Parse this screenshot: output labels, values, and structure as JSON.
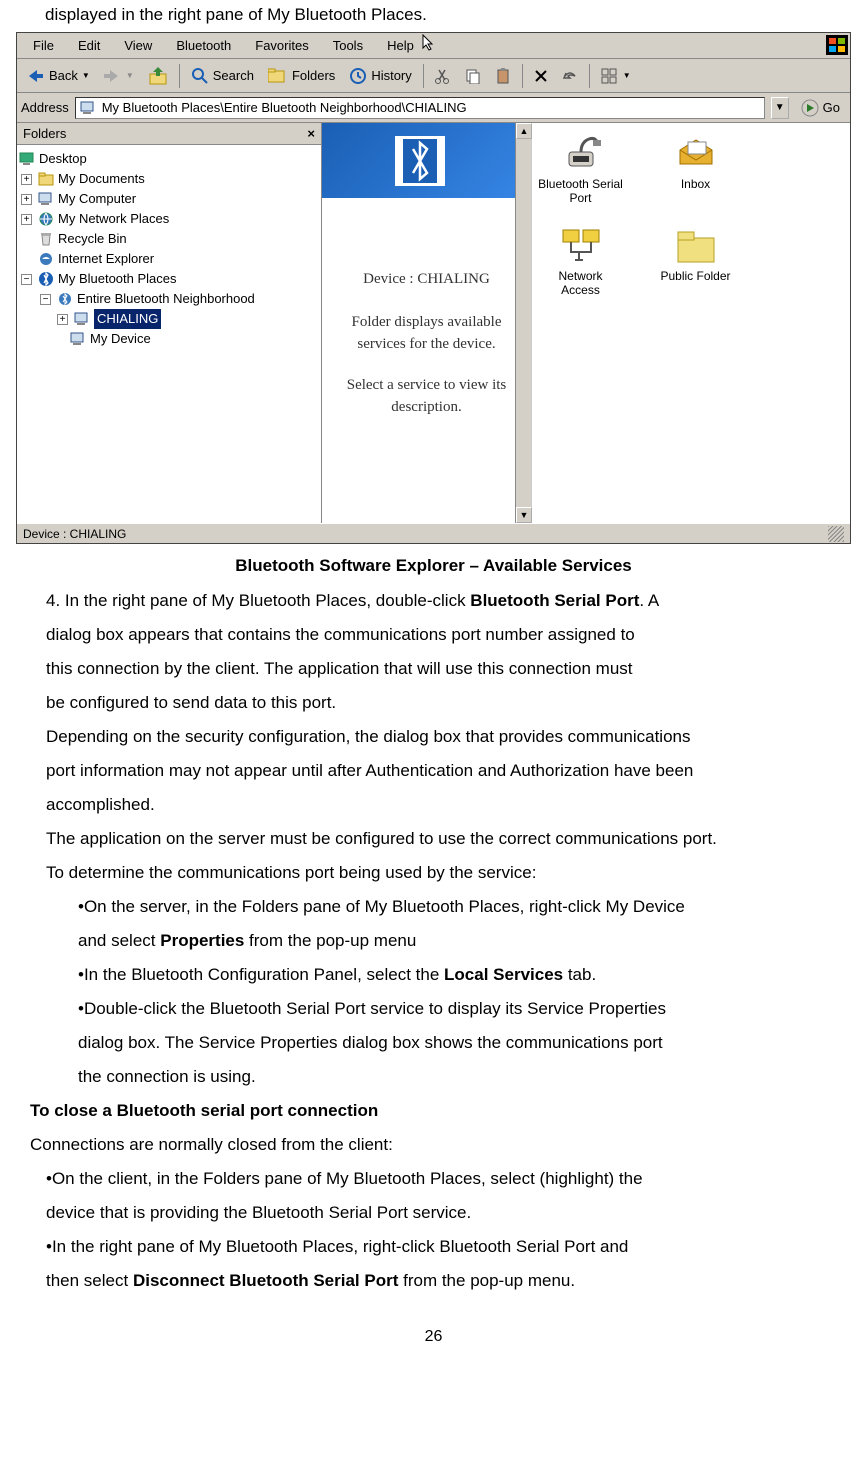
{
  "topline": "displayed in the right pane of My Bluetooth Places.",
  "menubar": [
    "File",
    "Edit",
    "View",
    "Bluetooth",
    "Favorites",
    "Tools",
    "Help"
  ],
  "toolbar": {
    "back": "Back",
    "search": "Search",
    "folders": "Folders",
    "history": "History"
  },
  "address": {
    "label": "Address",
    "path": "My Bluetooth Places\\Entire Bluetooth Neighborhood\\CHIALING",
    "go": "Go"
  },
  "folders": {
    "header": "Folders",
    "tree": {
      "desktop": "Desktop",
      "mydocs": "My Documents",
      "mycomp": "My Computer",
      "mynet": "My Network Places",
      "recycle": "Recycle Bin",
      "ie": "Internet Explorer",
      "btplaces": "My Bluetooth Places",
      "entire": "Entire Bluetooth Neighborhood",
      "chialing": "CHIALING",
      "mydevice": "My Device"
    }
  },
  "info": {
    "device": "Device : CHIALING",
    "line1": "Folder displays available services for the device.",
    "line2": "Select a service to view its description."
  },
  "services": {
    "serial": "Bluetooth Serial Port",
    "inbox": "Inbox",
    "network": "Network Access",
    "public": "Public Folder"
  },
  "statusbar": "Device : CHIALING",
  "caption": "Bluetooth Software Explorer – Available Services",
  "doc": {
    "p1a": "4. In the right pane of My Bluetooth Places, double-click ",
    "p1b": "Bluetooth Serial Port",
    "p1c": ". A",
    "p2": "dialog box appears that contains the communications port number assigned to",
    "p3": "this connection by the client. The application that will use this connection must",
    "p4": "be configured to send data to this port.",
    "p5": "Depending on the security configuration, the dialog box that provides communications",
    "p6": "port information may not appear until after Authentication and Authorization have been",
    "p7": "accomplished.",
    "p8": "The application on the server must be configured to use the correct communications port.",
    "p9": "To determine the communications port being used by the service:",
    "b1": "•On the server, in the Folders pane of My Bluetooth Places, right-click My Device",
    "b1b": "and select ",
    "b1c": "Properties",
    "b1d": " from the pop-up menu",
    "b2a": "•In the Bluetooth Configuration Panel, select the ",
    "b2b": "Local Services",
    "b2c": " tab.",
    "b3": "•Double-click the Bluetooth Serial Port service to display its Service Properties",
    "b3b": "dialog box. The Service Properties dialog box shows the communications port",
    "b3c": "the connection is using.",
    "h2": "To close a Bluetooth serial port connection",
    "p10": "Connections are normally closed from the client:",
    "c1": "•On the client, in the Folders pane of My Bluetooth Places, select (highlight) the",
    "c1b": "device that is providing the Bluetooth Serial Port service.",
    "c2": "•In the right pane of My Bluetooth Places, right-click Bluetooth Serial Port and",
    "c2b": "then select ",
    "c2c": "Disconnect Bluetooth Serial Port",
    "c2d": " from the pop-up menu."
  },
  "pagenum": "26"
}
